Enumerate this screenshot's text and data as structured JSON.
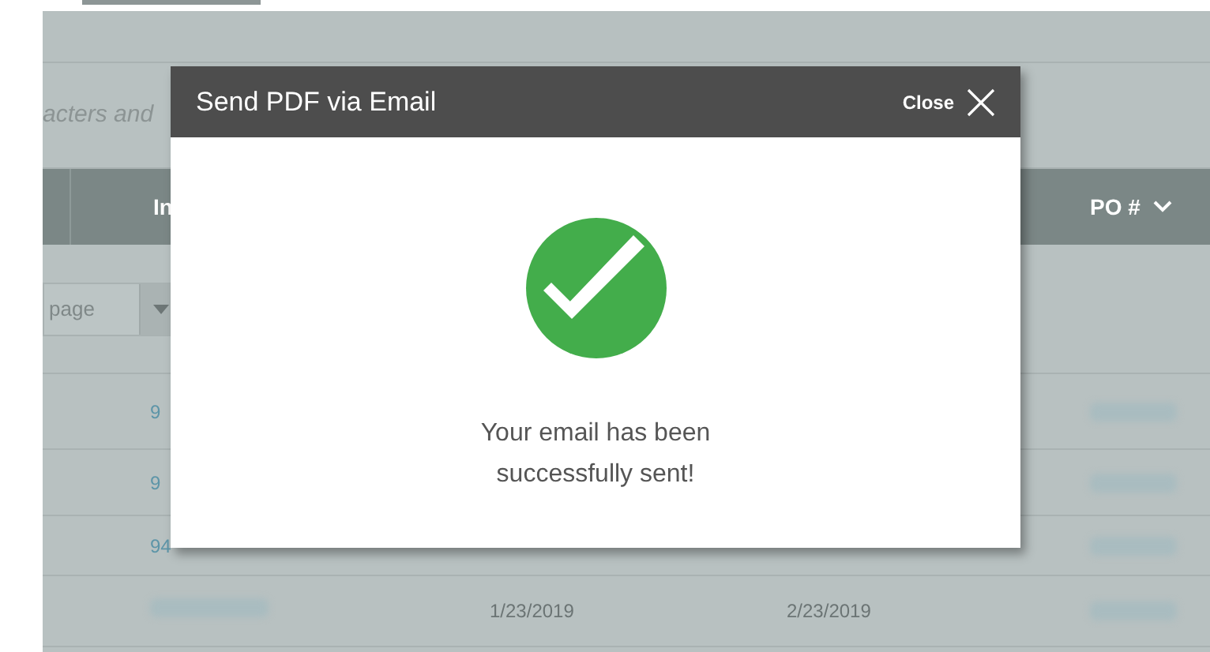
{
  "search": {
    "placeholder": "acters and"
  },
  "table": {
    "columns": [
      "In",
      "PO #"
    ],
    "per_page": "page",
    "rows": [
      {
        "invoice": "9"
      },
      {
        "invoice": "9"
      },
      {
        "invoice": "94"
      },
      {
        "date_1": "1/23/2019",
        "date_2": "2/23/2019"
      }
    ]
  },
  "modal": {
    "title": "Send PDF via Email",
    "close_label": "Close",
    "message": "Your email has been successfully sent!"
  }
}
